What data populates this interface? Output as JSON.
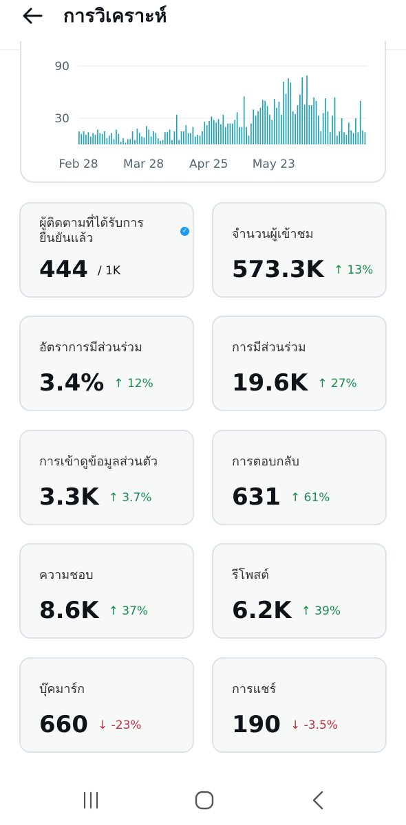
{
  "header": {
    "title": "การวิเคราะห์",
    "back_icon": "arrow-left-icon"
  },
  "chart_data": {
    "type": "bar",
    "ylim": [
      0,
      100
    ],
    "yticks": [
      30,
      90
    ],
    "xtick_labels": [
      "Feb 28",
      "Mar 28",
      "Apr 25",
      "May 23"
    ],
    "xtick_index": [
      0,
      28,
      56,
      84
    ],
    "color": "#1fa3b8",
    "values": [
      15,
      12,
      15,
      11,
      14,
      9,
      13,
      11,
      17,
      13,
      12,
      15,
      7,
      10,
      13,
      6,
      17,
      12,
      3,
      7,
      2,
      6,
      6,
      15,
      5,
      18,
      13,
      9,
      8,
      21,
      17,
      9,
      15,
      13,
      7,
      4,
      5,
      14,
      14,
      17,
      5,
      15,
      34,
      5,
      15,
      15,
      22,
      13,
      13,
      20,
      9,
      11,
      10,
      15,
      26,
      22,
      27,
      32,
      28,
      25,
      29,
      23,
      34,
      20,
      24,
      24,
      24,
      28,
      37,
      20,
      20,
      55,
      20,
      10,
      24,
      40,
      33,
      38,
      42,
      51,
      50,
      44,
      34,
      28,
      52,
      42,
      49,
      34,
      72,
      58,
      76,
      71,
      38,
      35,
      45,
      57,
      77,
      46,
      79,
      45,
      45,
      54,
      50,
      33,
      15,
      36,
      53,
      38,
      14,
      33,
      54,
      10,
      15,
      30,
      14,
      11,
      25,
      16,
      13,
      30,
      14,
      50,
      16,
      14
    ]
  },
  "cards": [
    {
      "label": "ผู้ติดตามที่ได้รับการยืนยันแล้ว",
      "value": "444",
      "sub": "/ 1K"
    },
    {
      "label": "จำนวนผู้เข้าชม",
      "value": "573.3K",
      "delta": "↑ 13%",
      "dir": "up"
    },
    {
      "label": "อัตราการมีส่วนร่วม",
      "value": "3.4%",
      "delta": "↑ 12%",
      "dir": "up"
    },
    {
      "label": "การมีส่วนร่วม",
      "value": "19.6K",
      "delta": "↑ 27%",
      "dir": "up"
    },
    {
      "label": "การเข้าดูข้อมูลส่วนตัว",
      "value": "3.3K",
      "delta": "↑ 3.7%",
      "dir": "up"
    },
    {
      "label": "การตอบกลับ",
      "value": "631",
      "delta": "↑ 61%",
      "dir": "up"
    },
    {
      "label": "ความชอบ",
      "value": "8.6K",
      "delta": "↑ 37%",
      "dir": "up"
    },
    {
      "label": "รีโพสต์",
      "value": "6.2K",
      "delta": "↑ 39%",
      "dir": "up"
    },
    {
      "label": "บุ๊คมาร์ก",
      "value": "660",
      "delta": "↓ -23%",
      "dir": "down"
    },
    {
      "label": "การแชร์",
      "value": "190",
      "delta": "↓ -3.5%",
      "dir": "down"
    }
  ],
  "navbar": {
    "recent_icon": "recent-apps-icon",
    "home_icon": "home-icon",
    "back_icon": "back-chevron-icon"
  },
  "colors": {
    "accent": "#1fa3b8",
    "up": "#1a8c4e",
    "down": "#c2303c",
    "verified": "#1d9bf0"
  }
}
